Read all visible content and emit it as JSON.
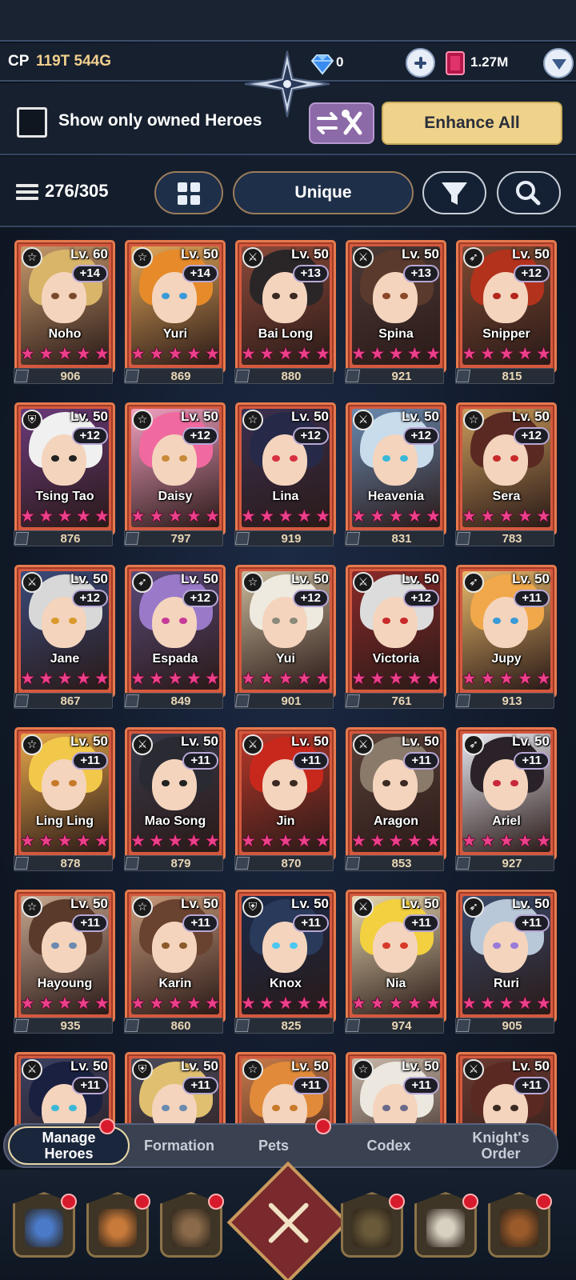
{
  "header": {
    "cp_label": "CP",
    "cp_value": "119T 544G",
    "gem_count": "0",
    "ruby_count": "1.27M"
  },
  "filters": {
    "owned_only_label": "Show only owned Heroes",
    "owned_only_checked": false,
    "enhance_all_label": "Enhance All"
  },
  "toolbar": {
    "hero_count": "276/305",
    "sort_label": "Unique"
  },
  "heroes": [
    {
      "name": "Noho",
      "level": "Lv. 60",
      "plus": "+14",
      "class": "star",
      "stars": 5,
      "power": "906",
      "hair": "#d9b56a",
      "bg": "#c69a6c",
      "eye": "#7a4b2a"
    },
    {
      "name": "Yuri",
      "level": "Lv. 50",
      "plus": "+14",
      "class": "star",
      "stars": 5,
      "power": "869",
      "hair": "#e68a2a",
      "bg": "#e3a85a",
      "eye": "#3a9ad8"
    },
    {
      "name": "Bai Long",
      "level": "Lv. 50",
      "plus": "+13",
      "class": "sword",
      "stars": 5,
      "power": "880",
      "hair": "#2a2628",
      "bg": "#8b4a3a",
      "eye": "#3a2a22"
    },
    {
      "name": "Spina",
      "level": "Lv. 50",
      "plus": "+13",
      "class": "sword",
      "stars": 5,
      "power": "921",
      "hair": "#5a3a2c",
      "bg": "#4c3a36",
      "eye": "#8a4a2a"
    },
    {
      "name": "Snipper",
      "level": "Lv. 50",
      "plus": "+12",
      "class": "bow",
      "stars": 5,
      "power": "815",
      "hair": "#b3321c",
      "bg": "#7e4a32",
      "eye": "#b3261c"
    },
    {
      "name": "Tsing Tao",
      "level": "Lv. 50",
      "plus": "+12",
      "class": "shield",
      "stars": 5,
      "power": "876",
      "hair": "#f0f0f0",
      "bg": "#6a3a7a",
      "eye": "#222222"
    },
    {
      "name": "Daisy",
      "level": "Lv. 50",
      "plus": "+12",
      "class": "star",
      "stars": 5,
      "power": "797",
      "hair": "#f06aa0",
      "bg": "#f2a0c0",
      "eye": "#c88a3a"
    },
    {
      "name": "Lina",
      "level": "Lv. 50",
      "plus": "+12",
      "class": "star",
      "stars": 5,
      "power": "919",
      "hair": "#262a48",
      "bg": "#3a3050",
      "eye": "#d83040"
    },
    {
      "name": "Heavenia",
      "level": "Lv. 50",
      "plus": "+12",
      "class": "sword",
      "stars": 5,
      "power": "831",
      "hair": "#c8dcec",
      "bg": "#6a8ab0",
      "eye": "#3ab8d8"
    },
    {
      "name": "Sera",
      "level": "Lv. 50",
      "plus": "+12",
      "class": "star",
      "stars": 5,
      "power": "783",
      "hair": "#5a2a22",
      "bg": "#c89a5a",
      "eye": "#c82a2a"
    },
    {
      "name": "Jane",
      "level": "Lv. 50",
      "plus": "+12",
      "class": "sword",
      "stars": 5,
      "power": "867",
      "hair": "#d8d8d8",
      "bg": "#3a4a7a",
      "eye": "#d89a2a"
    },
    {
      "name": "Espada",
      "level": "Lv. 50",
      "plus": "+12",
      "class": "bow",
      "stars": 5,
      "power": "849",
      "hair": "#9a7ac8",
      "bg": "#5a4a7a",
      "eye": "#c83a9a"
    },
    {
      "name": "Yui",
      "level": "Lv. 50",
      "plus": "+12",
      "class": "star",
      "stars": 5,
      "power": "901",
      "hair": "#eeeae0",
      "bg": "#c8b89a",
      "eye": "#8a8a7a"
    },
    {
      "name": "Victoria",
      "level": "Lv. 50",
      "plus": "+12",
      "class": "sword",
      "stars": 5,
      "power": "761",
      "hair": "#dcdcdc",
      "bg": "#8a2a2a",
      "eye": "#c82a2a"
    },
    {
      "name": "Jupy",
      "level": "Lv. 50",
      "plus": "+11",
      "class": "bow",
      "stars": 5,
      "power": "913",
      "hair": "#f0a84a",
      "bg": "#e8b86a",
      "eye": "#3a9ad8"
    },
    {
      "name": "Ling Ling",
      "level": "Lv. 50",
      "plus": "+11",
      "class": "star",
      "stars": 5,
      "power": "878",
      "hair": "#f2c84a",
      "bg": "#e8a84a",
      "eye": "#c87a2a"
    },
    {
      "name": "Mao Song",
      "level": "Lv. 50",
      "plus": "+11",
      "class": "sword",
      "stars": 5,
      "power": "879",
      "hair": "#2a2a32",
      "bg": "#3a3a4a",
      "eye": "#222222"
    },
    {
      "name": "Jin",
      "level": "Lv. 50",
      "plus": "+11",
      "class": "sword",
      "stars": 5,
      "power": "870",
      "hair": "#c8281c",
      "bg": "#b8382a",
      "eye": "#3a2a22"
    },
    {
      "name": "Aragon",
      "level": "Lv. 50",
      "plus": "+11",
      "class": "sword",
      "stars": 5,
      "power": "853",
      "hair": "#8a7a6a",
      "bg": "#5a4038",
      "eye": "#3a2a22"
    },
    {
      "name": "Ariel",
      "level": "Lv. 50",
      "plus": "+11",
      "class": "bow",
      "stars": 5,
      "power": "927",
      "hair": "#2a2228",
      "bg": "#e8e8f0",
      "eye": "#c8283a"
    },
    {
      "name": "Hayoung",
      "level": "Lv. 50",
      "plus": "+11",
      "class": "star",
      "stars": 5,
      "power": "935",
      "hair": "#5a3a2a",
      "bg": "#c8a890",
      "eye": "#6a8ab0"
    },
    {
      "name": "Karin",
      "level": "Lv. 50",
      "plus": "+11",
      "class": "star",
      "stars": 5,
      "power": "860",
      "hair": "#6a4230",
      "bg": "#c89a7a",
      "eye": "#8a5a2a"
    },
    {
      "name": "Knox",
      "level": "Lv. 50",
      "plus": "+11",
      "class": "shield",
      "stars": 5,
      "power": "825",
      "hair": "#2a3a5a",
      "bg": "#1a2a4a",
      "eye": "#4ac8f0"
    },
    {
      "name": "Nia",
      "level": "Lv. 50",
      "plus": "+11",
      "class": "sword",
      "stars": 5,
      "power": "974",
      "hair": "#f2d040",
      "bg": "#e8d8b0",
      "eye": "#d83a2a"
    },
    {
      "name": "Ruri",
      "level": "Lv. 50",
      "plus": "+11",
      "class": "bow",
      "stars": 5,
      "power": "905",
      "hair": "#b8c8d8",
      "bg": "#3a4a6a",
      "eye": "#9a7ad8"
    },
    {
      "name": "",
      "level": "Lv. 50",
      "plus": "+11",
      "class": "sword",
      "stars": 5,
      "power": "",
      "hair": "#1a2040",
      "bg": "#3a4060",
      "eye": "#3ab8d8"
    },
    {
      "name": "",
      "level": "Lv. 50",
      "plus": "+11",
      "class": "shield",
      "stars": 5,
      "power": "",
      "hair": "#e0c070",
      "bg": "#4a4a5a",
      "eye": "#6a8ab0"
    },
    {
      "name": "",
      "level": "Lv. 50",
      "plus": "+11",
      "class": "star",
      "stars": 5,
      "power": "",
      "hair": "#e08a3a",
      "bg": "#c87a4a",
      "eye": "#c87a2a"
    },
    {
      "name": "",
      "level": "Lv. 50",
      "plus": "+11",
      "class": "star",
      "stars": 5,
      "power": "",
      "hair": "#ece8e0",
      "bg": "#c8b8a8",
      "eye": "#6a6a8a"
    },
    {
      "name": "",
      "level": "Lv. 50",
      "plus": "+11",
      "class": "sword",
      "stars": 5,
      "power": "",
      "hair": "#5a2a22",
      "bg": "#6a3a30",
      "eye": "#3a2a22"
    }
  ],
  "tabs": [
    {
      "label": "Manage Heroes",
      "active": true,
      "badge": true
    },
    {
      "label": "Formation",
      "active": false,
      "badge": false
    },
    {
      "label": "Pets",
      "active": false,
      "badge": true
    },
    {
      "label": "Codex",
      "active": false,
      "badge": false
    },
    {
      "label": "Knight's Order",
      "active": false,
      "badge": false
    }
  ],
  "nav": [
    {
      "icon": "heroes-icon",
      "badge": true,
      "color": "#4a7ac8"
    },
    {
      "icon": "equipment-icon",
      "badge": true,
      "color": "#c87a3a"
    },
    {
      "icon": "book-icon",
      "badge": true,
      "color": "#8a6a4a"
    },
    {
      "icon": "close-icon",
      "badge": false,
      "color": "#7a2a2c"
    },
    {
      "icon": "guild-icon",
      "badge": true,
      "color": "#6a5a3a"
    },
    {
      "icon": "quest-scroll-icon",
      "badge": true,
      "color": "#d8d0c0"
    },
    {
      "icon": "treasure-chest-icon",
      "badge": true,
      "color": "#9a5a2a"
    }
  ]
}
